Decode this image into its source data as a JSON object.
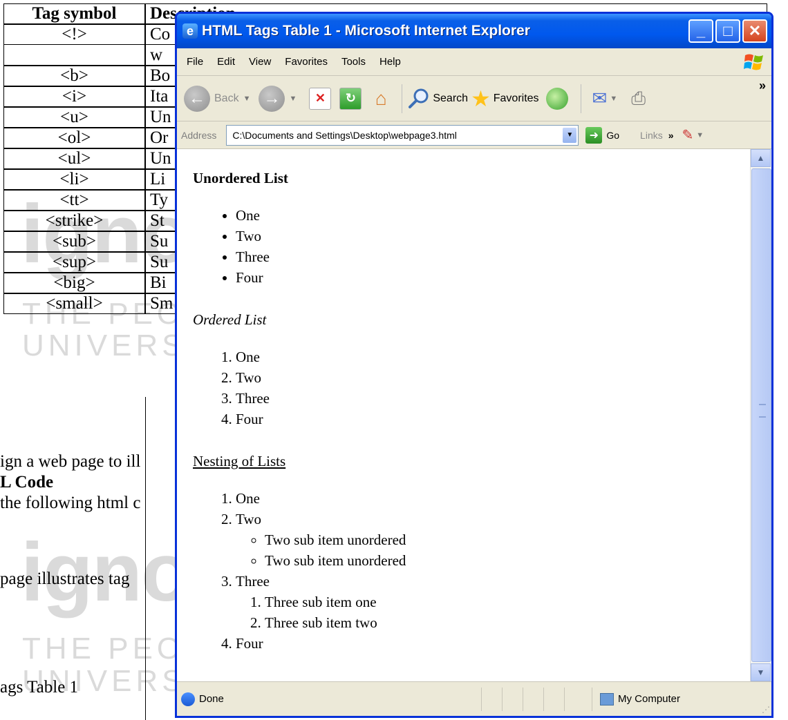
{
  "watermark": {
    "word": "ignou",
    "people": "THE PEOPLE'S",
    "university": "UNIVERSITY"
  },
  "doc": {
    "headers": [
      "Tag symbol",
      "Description"
    ],
    "rows": [
      {
        "tag": "<!>",
        "desc": "Co"
      },
      {
        "tag": "",
        "desc": "w"
      },
      {
        "tag": "<b>",
        "desc": "Bo"
      },
      {
        "tag": "<i>",
        "desc": "Ita"
      },
      {
        "tag": "<u>",
        "desc": "Un"
      },
      {
        "tag": "<ol>",
        "desc": "Or"
      },
      {
        "tag": "<ul>",
        "desc": "Un"
      },
      {
        "tag": "<li>",
        "desc": "Li"
      },
      {
        "tag": "<tt>",
        "desc": "Ty"
      },
      {
        "tag": "<strike>",
        "desc": "St"
      },
      {
        "tag": "<sub>",
        "desc": "Su"
      },
      {
        "tag": "<sup>",
        "desc": "Su"
      },
      {
        "tag": "<big>",
        "desc": "Bi"
      },
      {
        "tag": "<small>",
        "desc": "Sm"
      }
    ],
    "texts": {
      "line1": "ign a web page to ill",
      "line2": "L Code",
      "line3": "the following html c",
      "line4": "page illustrates tag",
      "line5": "ags Table 1"
    }
  },
  "window": {
    "title": "HTML Tags Table 1 - Microsoft Internet Explorer",
    "menu": [
      "File",
      "Edit",
      "View",
      "Favorites",
      "Tools",
      "Help"
    ],
    "toolbar": {
      "back": "Back",
      "search": "Search",
      "favorites": "Favorites"
    },
    "address": {
      "label": "Address",
      "value": "C:\\Documents and Settings\\Desktop\\webpage3.html",
      "go": "Go",
      "links": "Links"
    },
    "status": {
      "text": "Done",
      "zone": "My Computer"
    }
  },
  "page": {
    "unordered_title": "Unordered List",
    "unordered_items": [
      "One",
      "Two",
      "Three",
      "Four"
    ],
    "ordered_title": "Ordered List",
    "ordered_items": [
      "One",
      "Two",
      "Three",
      "Four"
    ],
    "nesting_title": "Nesting of Lists",
    "nest": {
      "item1": "One",
      "item2": "Two",
      "sub_unordered": [
        "Two sub item unordered",
        "Two sub item unordered"
      ],
      "item3": "Three",
      "sub_ordered": [
        "Three sub item one",
        "Three sub item two"
      ],
      "item4": "Four"
    }
  }
}
